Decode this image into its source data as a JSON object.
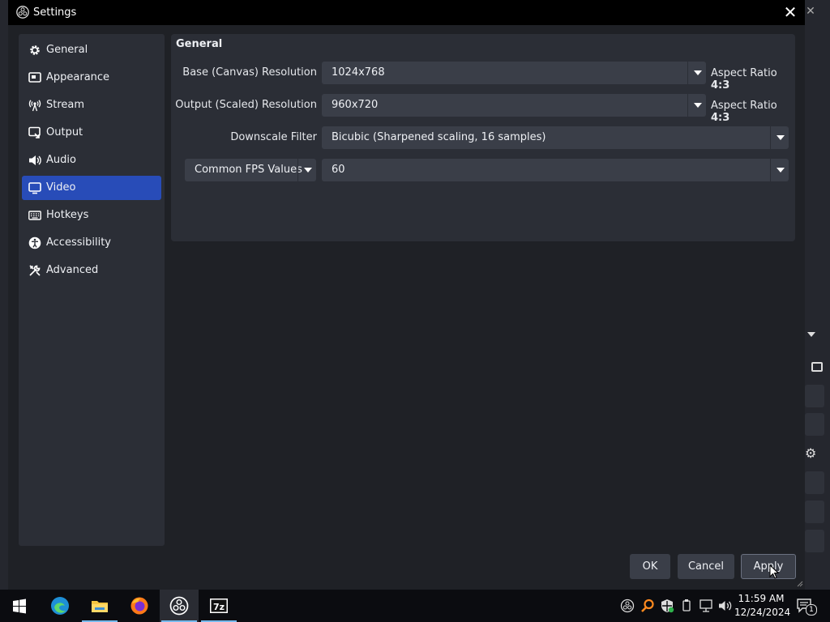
{
  "window": {
    "title": "Settings"
  },
  "sidebar": {
    "items": [
      {
        "label": "General",
        "icon": "gear-icon"
      },
      {
        "label": "Appearance",
        "icon": "appearance-icon"
      },
      {
        "label": "Stream",
        "icon": "broadcast-icon"
      },
      {
        "label": "Output",
        "icon": "output-icon"
      },
      {
        "label": "Audio",
        "icon": "speaker-icon"
      },
      {
        "label": "Video",
        "icon": "monitor-icon",
        "active": true
      },
      {
        "label": "Hotkeys",
        "icon": "keyboard-icon"
      },
      {
        "label": "Accessibility",
        "icon": "accessibility-icon"
      },
      {
        "label": "Advanced",
        "icon": "tools-icon"
      }
    ]
  },
  "video": {
    "section_title": "General",
    "base_label": "Base (Canvas) Resolution",
    "base_value": "1024x768",
    "base_aspect_label": "Aspect Ratio",
    "base_aspect_value": "4:3",
    "output_label": "Output (Scaled) Resolution",
    "output_value": "960x720",
    "output_aspect_label": "Aspect Ratio",
    "output_aspect_value": "4:3",
    "filter_label": "Downscale Filter",
    "filter_value": "Bicubic (Sharpened scaling, 16 samples)",
    "fps_type": "Common FPS Values",
    "fps_value": "60"
  },
  "buttons": {
    "ok": "OK",
    "cancel": "Cancel",
    "apply": "Apply"
  },
  "taskbar": {
    "apps": [
      "start-icon",
      "edge-icon",
      "file-explorer-icon",
      "firefox-icon",
      "obs-icon",
      "7zip-icon"
    ],
    "clock_time": "11:59 AM",
    "clock_date": "12/24/2024",
    "notification_count": "1"
  },
  "colors": {
    "accent": "#284cb8",
    "panel": "#2b2e36",
    "input": "#3a3e48",
    "background": "#1f2126"
  }
}
